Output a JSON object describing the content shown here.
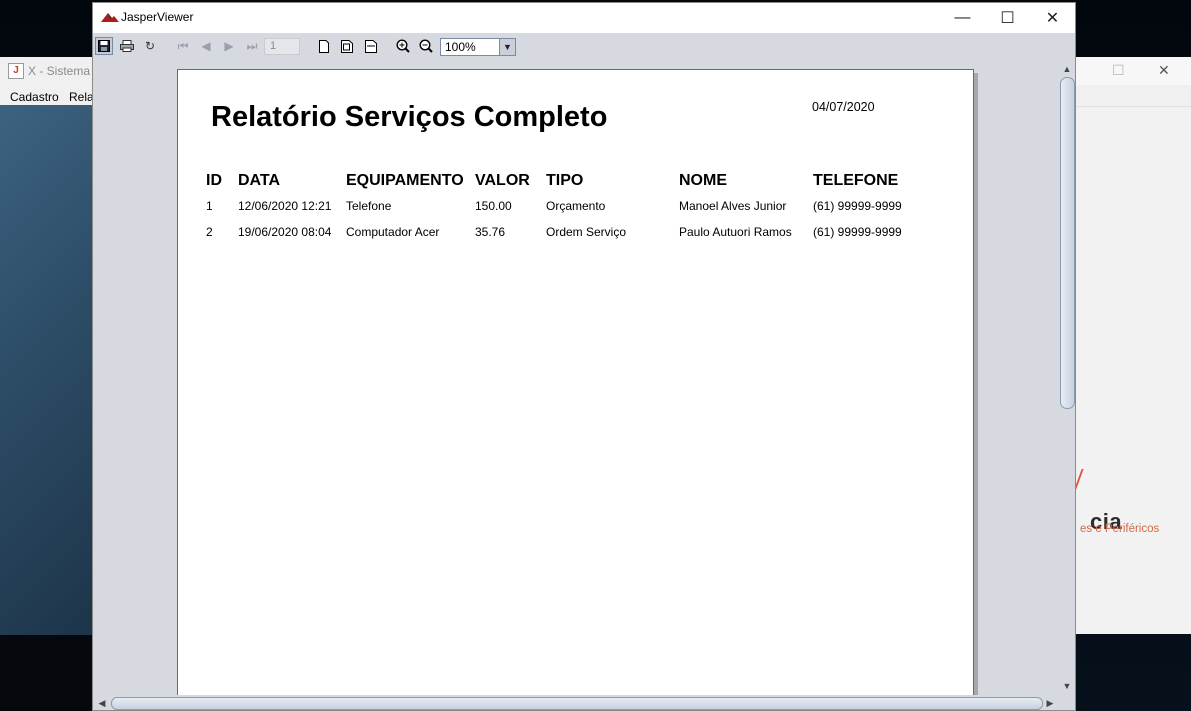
{
  "background_app": {
    "title": "X - Sistema",
    "menu": [
      "Cadastro",
      "Rela"
    ],
    "logo_word": "cia",
    "logo_sub": "es e Periféricos"
  },
  "window": {
    "title": "JasperViewer",
    "controls": {
      "minimize": "—",
      "maximize": "☐",
      "close": "✕"
    }
  },
  "toolbar": {
    "page_number": "1",
    "zoom": "100%",
    "icons": [
      "save-icon",
      "print-icon",
      "reload-icon",
      "first-page-icon",
      "previous-page-icon",
      "next-page-icon",
      "last-page-icon",
      "actual-size-icon",
      "fit-page-icon",
      "fit-width-icon",
      "zoom-in-icon",
      "zoom-out-icon"
    ]
  },
  "report": {
    "title": "Relatório Serviços Completo",
    "date": "04/07/2020",
    "columns": [
      "ID",
      "DATA",
      "EQUIPAMENTO",
      "VALOR",
      "TIPO",
      "NOME",
      "TELEFONE"
    ],
    "rows": [
      [
        "1",
        "12/06/2020 12:21",
        "Telefone",
        "150.00",
        "Orçamento",
        "Manoel Alves Junior",
        "(61) 99999-9999"
      ],
      [
        "2",
        "19/06/2020 08:04",
        "Computador Acer",
        "35.76",
        "Ordem Serviço",
        "Paulo Autuori Ramos",
        "(61) 99999-9999"
      ]
    ]
  }
}
